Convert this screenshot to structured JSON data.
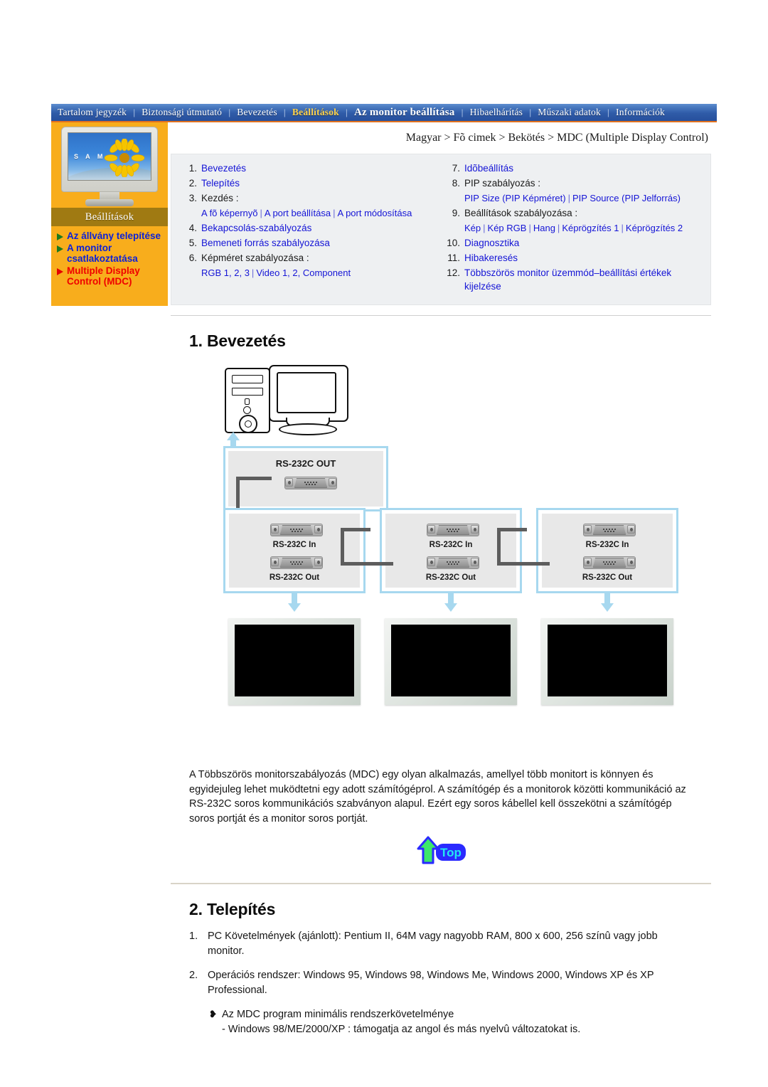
{
  "nav": {
    "items": [
      {
        "label": "Tartalom jegyzék",
        "state": "normal"
      },
      {
        "label": "Biztonsági útmutató",
        "state": "normal"
      },
      {
        "label": "Bevezetés",
        "state": "normal"
      },
      {
        "label": "Beállítások",
        "state": "active"
      },
      {
        "label": "Az monitor beállítása",
        "state": "current"
      },
      {
        "label": "Hibaelhárítás",
        "state": "normal"
      },
      {
        "label": "Műszaki adatok",
        "state": "normal"
      },
      {
        "label": "Információk",
        "state": "normal"
      }
    ],
    "separator": "|",
    "accent_color": "#e2711d",
    "active_color": "#ffd24a"
  },
  "sidebar": {
    "brand_text": "S A M",
    "title": "Beállítások",
    "items": [
      {
        "label": "Az állvány telepítése",
        "state": "normal",
        "marker_color": "#1d7a1d"
      },
      {
        "label": "A monitor csatlakoztatása",
        "state": "normal",
        "marker_color": "#1d7a1d"
      },
      {
        "label": "Multiple Display Control (MDC)",
        "state": "active",
        "marker_color": "#e50000"
      }
    ]
  },
  "breadcrumb": "Magyar > Fõ cimek > Bekötés > MDC (Multiple Display Control)",
  "toc": {
    "left": [
      {
        "num": "1.",
        "text": "Bevezetés",
        "link": true
      },
      {
        "num": "2.",
        "text": "Telepítés",
        "link": true
      },
      {
        "num": "3.",
        "text": "Kezdés :",
        "link": false,
        "sub": [
          "A fõ képernyõ",
          "A port beállítása",
          "A port módosítása"
        ]
      },
      {
        "num": "4.",
        "text": "Bekapcsolás-szabályozás",
        "link": true
      },
      {
        "num": "5.",
        "text": "Bemeneti forrás szabályozása",
        "link": true
      },
      {
        "num": "6.",
        "text": "Képméret szabályozása :",
        "link": false,
        "sub": [
          "RGB 1, 2, 3",
          "Video 1, 2, Component"
        ]
      }
    ],
    "right": [
      {
        "num": "7.",
        "text": "Idõbeállítás",
        "link": true
      },
      {
        "num": "8.",
        "text": "PIP szabályozás :",
        "link": false,
        "sub": [
          "PIP Size (PIP Képméret)",
          "PIP Source (PIP Jelforrás)"
        ]
      },
      {
        "num": "9.",
        "text": "Beállítások szabályozása :",
        "link": false,
        "sub": [
          "Kép",
          "Kép RGB",
          "Hang",
          "Képrögzítés 1",
          "Képrögzítés 2"
        ]
      },
      {
        "num": "10.",
        "text": "Diagnosztika",
        "link": true
      },
      {
        "num": "11.",
        "text": "Hibakeresés",
        "link": true
      },
      {
        "num": "12.",
        "text": "Többszörös monitor üzemmód–beállítási értékek kijelzése",
        "link": true
      }
    ]
  },
  "section1": {
    "heading": "1. Bevezetés",
    "diagram": {
      "pc_label": "",
      "out_port_label": "RS-232C OUT",
      "monitors": [
        {
          "in_label": "RS-232C In",
          "out_label": "RS-232C Out"
        },
        {
          "in_label": "RS-232C In",
          "out_label": "RS-232C Out"
        },
        {
          "in_label": "RS-232C In",
          "out_label": "RS-232C Out"
        }
      ]
    },
    "paragraph": "A Többszörös monitorszabályozás (MDC) egy olyan alkalmazás, amellyel több monitort is könnyen és egyidejuleg lehet muködtetni egy adott számítógéprol. A számítógép és a monitorok közötti kommunikáció az RS-232C soros kommunikációs szabványon alapul. Ezért egy soros kábellel kell összekötni a számítógép soros portját és a monitor soros portját."
  },
  "top_button": {
    "label": "Top"
  },
  "section2": {
    "heading": "2. Telepítés",
    "items": [
      {
        "num": "1.",
        "text": "PC Követelmények (ajánlott): Pentium II, 64M vagy nagyobb RAM, 800 x 600, 256 színû vagy jobb monitor."
      },
      {
        "num": "2.",
        "text": "Operációs rendszer: Windows 95, Windows 98, Windows Me, Windows 2000, Windows XP és XP Professional."
      }
    ],
    "bullet": {
      "marker": "❥",
      "title": "Az MDC program minimális rendszerkövetelménye",
      "detail": "- Windows 98/ME/2000/XP : támogatja az angol és más nyelvû változatokat is."
    }
  }
}
